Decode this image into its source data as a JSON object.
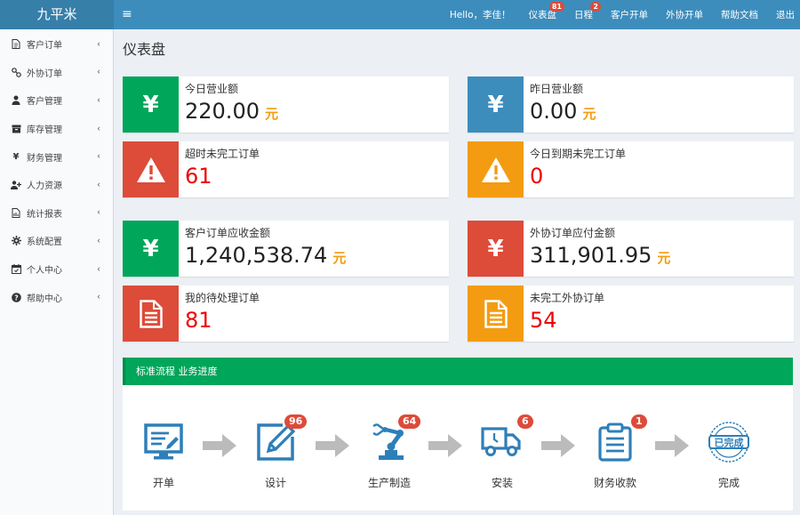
{
  "header": {
    "logo": "九平米",
    "toggle": "≡",
    "greeting": "Hello，李佳！",
    "links": [
      {
        "label": "仪表盘",
        "badge": "81"
      },
      {
        "label": "日程",
        "badge": "2"
      },
      {
        "label": "客户开单"
      },
      {
        "label": "外协开单"
      },
      {
        "label": "帮助文档"
      },
      {
        "label": "退出"
      }
    ]
  },
  "sidebar": {
    "items": [
      {
        "label": "客户订单",
        "icon": "file-icon"
      },
      {
        "label": "外协订单",
        "icon": "link-icon"
      },
      {
        "label": "客户管理",
        "icon": "user-icon"
      },
      {
        "label": "库存管理",
        "icon": "inbox-icon"
      },
      {
        "label": "财务管理",
        "icon": "yen-icon"
      },
      {
        "label": "人力资源",
        "icon": "user-plus-icon"
      },
      {
        "label": "统计报表",
        "icon": "report-icon"
      },
      {
        "label": "系统配置",
        "icon": "gear-icon"
      },
      {
        "label": "个人中心",
        "icon": "calendar-icon"
      },
      {
        "label": "帮助中心",
        "icon": "question-icon"
      }
    ],
    "chevron": "‹"
  },
  "page_title": "仪表盘",
  "stats": [
    {
      "label": "今日营业额",
      "value": "220.00",
      "unit": "元",
      "icon": "yen-icon",
      "color": "#00a65a"
    },
    {
      "label": "昨日营业额",
      "value": "0.00",
      "unit": "元",
      "icon": "yen-icon",
      "color": "#3c8dbc"
    },
    {
      "label": "超时未完工订单",
      "value": "61",
      "icon": "warning-icon",
      "color": "#dd4b39"
    },
    {
      "label": "今日到期未完工订单",
      "value": "0",
      "icon": "warning-icon",
      "color": "#f39c12"
    },
    {
      "label": "客户订单应收金额",
      "value": "1,240,538.74",
      "unit": "元",
      "icon": "yen-icon",
      "color": "#00a65a"
    },
    {
      "label": "外协订单应付金额",
      "value": "311,901.95",
      "unit": "元",
      "icon": "yen-icon",
      "color": "#dd4b39"
    },
    {
      "label": "我的待处理订单",
      "value": "81",
      "icon": "document-icon",
      "color": "#dd4b39"
    },
    {
      "label": "未完工外协订单",
      "value": "54",
      "icon": "document-icon",
      "color": "#f39c12"
    }
  ],
  "process": {
    "title": "标准流程 业务进度",
    "steps": [
      {
        "label": "开单",
        "icon": "monitor-icon"
      },
      {
        "label": "设计",
        "icon": "edit-icon",
        "badge": "96"
      },
      {
        "label": "生产制造",
        "icon": "robot-arm-icon",
        "badge": "64"
      },
      {
        "label": "安装",
        "icon": "truck-icon",
        "badge": "6"
      },
      {
        "label": "财务收款",
        "icon": "clipboard-icon",
        "badge": "1"
      },
      {
        "label": "完成",
        "icon": "completed-stamp-icon",
        "stamp": "已完成"
      }
    ]
  }
}
